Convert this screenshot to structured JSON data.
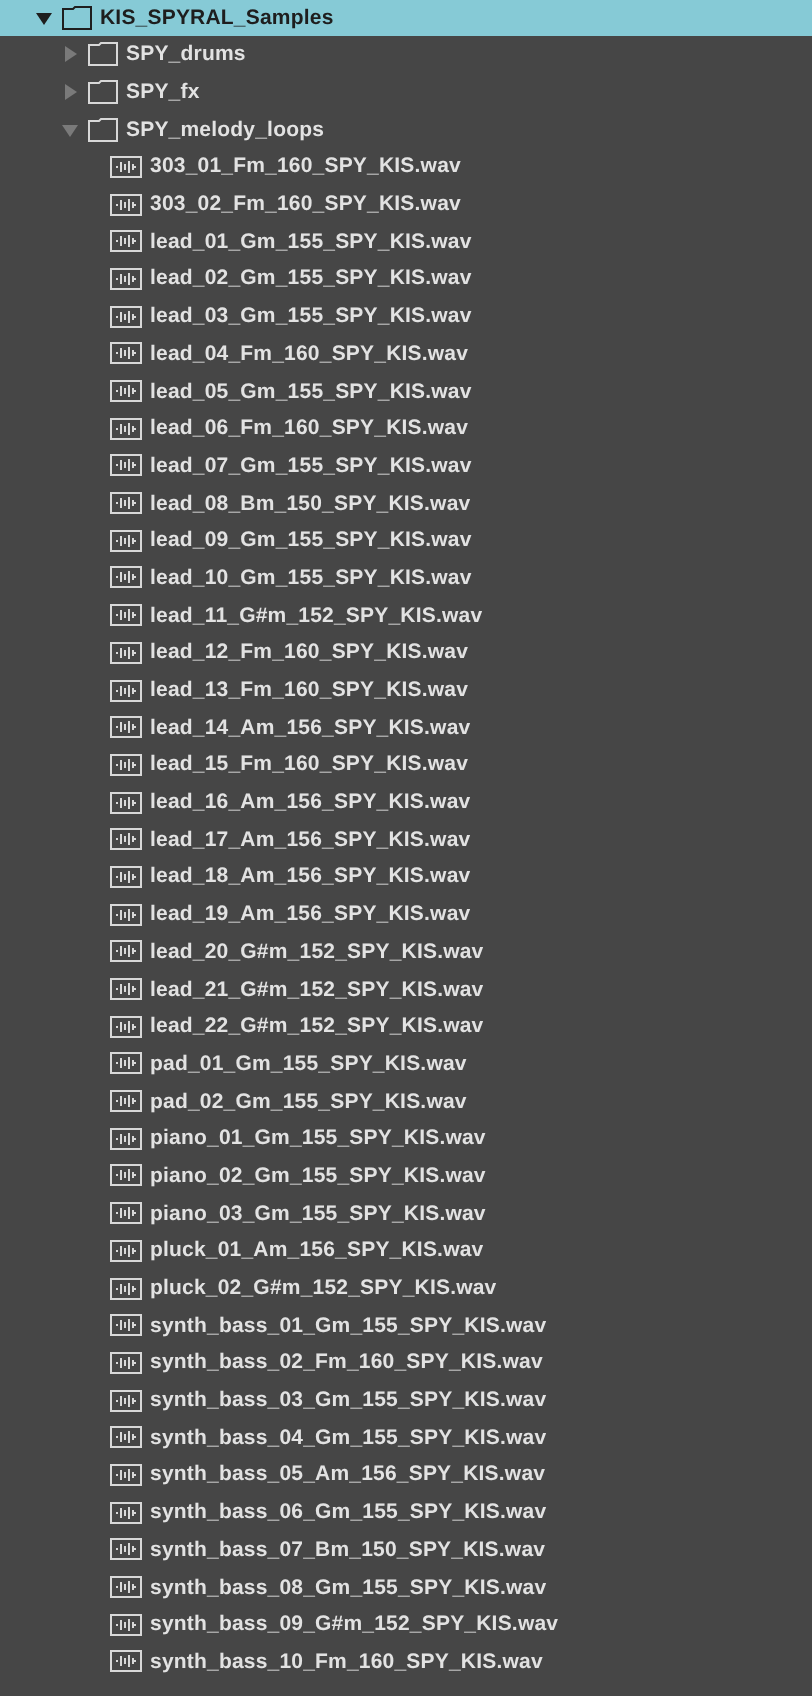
{
  "tree": [
    {
      "kind": "folder",
      "name": "KIS_SPYRAL_Samples",
      "expanded": true,
      "selected": true,
      "children": [
        {
          "kind": "folder",
          "name": "SPY_drums",
          "expanded": false,
          "selected": false
        },
        {
          "kind": "folder",
          "name": "SPY_fx",
          "expanded": false,
          "selected": false
        },
        {
          "kind": "folder",
          "name": "SPY_melody_loops",
          "expanded": true,
          "selected": false,
          "children": [
            {
              "kind": "file",
              "name": "303_01_Fm_160_SPY_KIS.wav",
              "selected": false
            },
            {
              "kind": "file",
              "name": "303_02_Fm_160_SPY_KIS.wav",
              "selected": false
            },
            {
              "kind": "file",
              "name": "lead_01_Gm_155_SPY_KIS.wav",
              "selected": false
            },
            {
              "kind": "file",
              "name": "lead_02_Gm_155_SPY_KIS.wav",
              "selected": false
            },
            {
              "kind": "file",
              "name": "lead_03_Gm_155_SPY_KIS.wav",
              "selected": false
            },
            {
              "kind": "file",
              "name": "lead_04_Fm_160_SPY_KIS.wav",
              "selected": false
            },
            {
              "kind": "file",
              "name": "lead_05_Gm_155_SPY_KIS.wav",
              "selected": false
            },
            {
              "kind": "file",
              "name": "lead_06_Fm_160_SPY_KIS.wav",
              "selected": false
            },
            {
              "kind": "file",
              "name": "lead_07_Gm_155_SPY_KIS.wav",
              "selected": false
            },
            {
              "kind": "file",
              "name": "lead_08_Bm_150_SPY_KIS.wav",
              "selected": false
            },
            {
              "kind": "file",
              "name": "lead_09_Gm_155_SPY_KIS.wav",
              "selected": false
            },
            {
              "kind": "file",
              "name": "lead_10_Gm_155_SPY_KIS.wav",
              "selected": false
            },
            {
              "kind": "file",
              "name": "lead_11_G#m_152_SPY_KIS.wav",
              "selected": false
            },
            {
              "kind": "file",
              "name": "lead_12_Fm_160_SPY_KIS.wav",
              "selected": false
            },
            {
              "kind": "file",
              "name": "lead_13_Fm_160_SPY_KIS.wav",
              "selected": false
            },
            {
              "kind": "file",
              "name": "lead_14_Am_156_SPY_KIS.wav",
              "selected": false
            },
            {
              "kind": "file",
              "name": "lead_15_Fm_160_SPY_KIS.wav",
              "selected": false
            },
            {
              "kind": "file",
              "name": "lead_16_Am_156_SPY_KIS.wav",
              "selected": false
            },
            {
              "kind": "file",
              "name": "lead_17_Am_156_SPY_KIS.wav",
              "selected": false
            },
            {
              "kind": "file",
              "name": "lead_18_Am_156_SPY_KIS.wav",
              "selected": false
            },
            {
              "kind": "file",
              "name": "lead_19_Am_156_SPY_KIS.wav",
              "selected": false
            },
            {
              "kind": "file",
              "name": "lead_20_G#m_152_SPY_KIS.wav",
              "selected": false
            },
            {
              "kind": "file",
              "name": "lead_21_G#m_152_SPY_KIS.wav",
              "selected": false
            },
            {
              "kind": "file",
              "name": "lead_22_G#m_152_SPY_KIS.wav",
              "selected": false
            },
            {
              "kind": "file",
              "name": "pad_01_Gm_155_SPY_KIS.wav",
              "selected": false
            },
            {
              "kind": "file",
              "name": "pad_02_Gm_155_SPY_KIS.wav",
              "selected": false
            },
            {
              "kind": "file",
              "name": "piano_01_Gm_155_SPY_KIS.wav",
              "selected": false
            },
            {
              "kind": "file",
              "name": "piano_02_Gm_155_SPY_KIS.wav",
              "selected": false
            },
            {
              "kind": "file",
              "name": "piano_03_Gm_155_SPY_KIS.wav",
              "selected": false
            },
            {
              "kind": "file",
              "name": "pluck_01_Am_156_SPY_KIS.wav",
              "selected": false
            },
            {
              "kind": "file",
              "name": "pluck_02_G#m_152_SPY_KIS.wav",
              "selected": false
            },
            {
              "kind": "file",
              "name": "synth_bass_01_Gm_155_SPY_KIS.wav",
              "selected": false
            },
            {
              "kind": "file",
              "name": "synth_bass_02_Fm_160_SPY_KIS.wav",
              "selected": false
            },
            {
              "kind": "file",
              "name": "synth_bass_03_Gm_155_SPY_KIS.wav",
              "selected": false
            },
            {
              "kind": "file",
              "name": "synth_bass_04_Gm_155_SPY_KIS.wav",
              "selected": false
            },
            {
              "kind": "file",
              "name": "synth_bass_05_Am_156_SPY_KIS.wav",
              "selected": false
            },
            {
              "kind": "file",
              "name": "synth_bass_06_Gm_155_SPY_KIS.wav",
              "selected": false
            },
            {
              "kind": "file",
              "name": "synth_bass_07_Bm_150_SPY_KIS.wav",
              "selected": false
            },
            {
              "kind": "file",
              "name": "synth_bass_08_Gm_155_SPY_KIS.wav",
              "selected": false
            },
            {
              "kind": "file",
              "name": "synth_bass_09_G#m_152_SPY_KIS.wav",
              "selected": false
            },
            {
              "kind": "file",
              "name": "synth_bass_10_Fm_160_SPY_KIS.wav",
              "selected": false
            }
          ]
        }
      ]
    }
  ]
}
